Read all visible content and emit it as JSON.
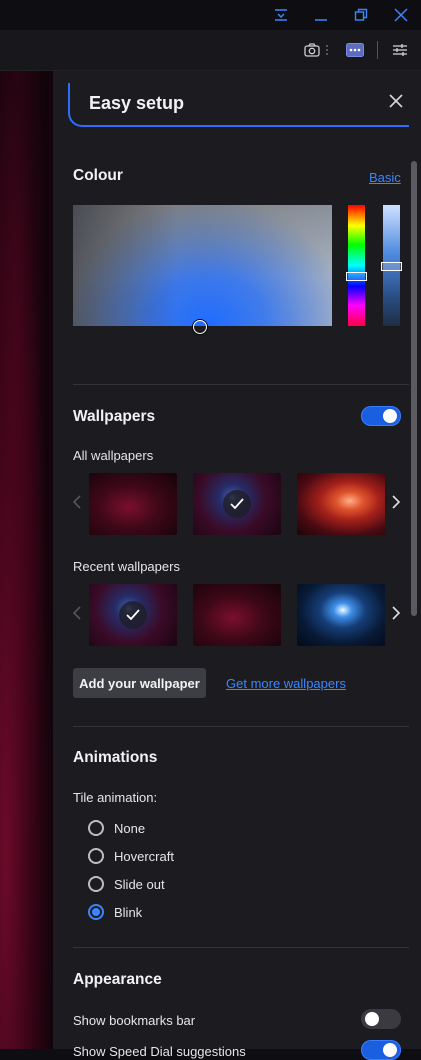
{
  "window": {
    "icons": [
      "menu-down-icon",
      "minimize-icon",
      "restore-icon",
      "close-icon"
    ]
  },
  "toolbar": {
    "icons": [
      "camera-icon",
      "more-icon",
      "easy-setup-icon"
    ]
  },
  "panel": {
    "title": "Easy setup",
    "colour": {
      "title": "Colour",
      "mode_link": "Basic",
      "accent": "#1f6cff"
    },
    "wallpapers": {
      "title": "Wallpapers",
      "enabled": true,
      "all_label": "All wallpapers",
      "all_items": [
        {
          "name": "red-nebula",
          "selected": false
        },
        {
          "name": "blue-nebula",
          "selected": true
        },
        {
          "name": "orange-galaxy",
          "selected": false
        }
      ],
      "recent_label": "Recent wallpapers",
      "recent_items": [
        {
          "name": "blue-nebula",
          "selected": true
        },
        {
          "name": "red-nebula",
          "selected": false
        },
        {
          "name": "blue-planet",
          "selected": false
        }
      ],
      "add_button": "Add your wallpaper",
      "more_link": "Get more wallpapers"
    },
    "animations": {
      "title": "Animations",
      "tile_label": "Tile animation:",
      "options": [
        "None",
        "Hovercraft",
        "Slide out",
        "Blink"
      ],
      "selected": "Blink"
    },
    "appearance": {
      "title": "Appearance",
      "bookmarks_label": "Show bookmarks bar",
      "bookmarks_enabled": false,
      "partial_label": "Show Speed Dial suggestions",
      "partial_enabled": true
    }
  }
}
